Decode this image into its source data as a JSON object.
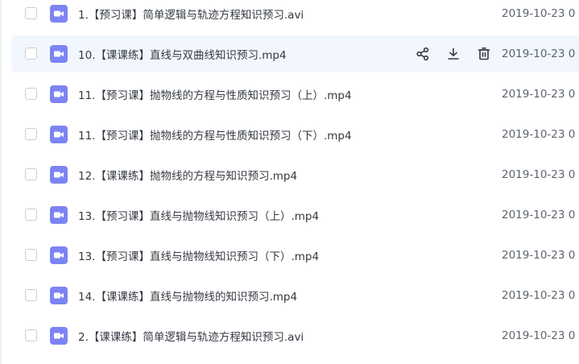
{
  "files": [
    {
      "name": "1.【预习课】简单逻辑与轨迹方程知识预习.avi",
      "date": "2019-10-23 0",
      "selected": false
    },
    {
      "name": "10.【课课练】直线与双曲线知识预习.mp4",
      "date": "2019-10-23 0",
      "selected": true
    },
    {
      "name": "11.【预习课】抛物线的方程与性质知识预习（上）.mp4",
      "date": "2019-10-23 0",
      "selected": false
    },
    {
      "name": "11.【预习课】抛物线的方程与性质知识预习（下）.mp4",
      "date": "2019-10-23 0",
      "selected": false
    },
    {
      "name": "12.【课课练】抛物线的方程与知识预习.mp4",
      "date": "2019-10-23 0",
      "selected": false
    },
    {
      "name": "13.【预习课】直线与抛物线知识预习（上）.mp4",
      "date": "2019-10-23 0",
      "selected": false
    },
    {
      "name": "13.【预习课】直线与抛物线知识预习（下）.mp4",
      "date": "2019-10-23 0",
      "selected": false
    },
    {
      "name": "14.【课课练】直线与抛物线的知识预习.mp4",
      "date": "2019-10-23 0",
      "selected": false
    },
    {
      "name": "2.【课课练】简单逻辑与轨迹方程知识预习.avi",
      "date": "2019-10-23 0",
      "selected": false
    }
  ],
  "row_actions": [
    "share-icon",
    "download-icon",
    "delete-icon"
  ],
  "colors": {
    "video_icon": "#7c84f5",
    "selected_row_bg": "#f2f7fe",
    "text": "#333942",
    "date_text": "#5c6470",
    "action_icon": "#333942"
  }
}
